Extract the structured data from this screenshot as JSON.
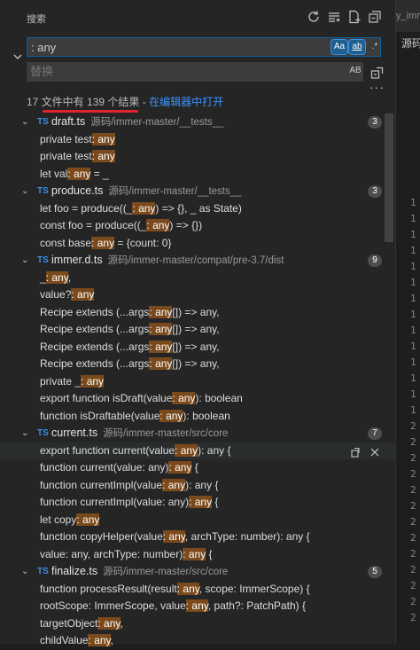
{
  "header": {
    "title": "搜索",
    "icons": [
      "refresh-icon",
      "clear-results-icon",
      "new-search-editor-icon",
      "collapse-all-icon"
    ]
  },
  "search": {
    "value": ": any",
    "options": [
      "Aa",
      "ab",
      ".*"
    ]
  },
  "replace": {
    "placeholder": "替换",
    "preserve_case": "AB"
  },
  "summary": {
    "prefix": "17 文件中有 ",
    "count": "139",
    "suffix": " 个结果 - ",
    "open_link": "在编辑器中打开"
  },
  "editor": {
    "tab": "y_imm",
    "crumb": "源码",
    "lines": [
      "1",
      "1",
      "1",
      "1",
      "1",
      "1",
      "1",
      "1",
      "1",
      "1",
      "1",
      "1",
      "1",
      "1",
      "2",
      "2",
      "2",
      "2",
      "2",
      "2",
      "2",
      "2",
      "2",
      "2",
      "2",
      "2",
      "2"
    ]
  },
  "files": [
    {
      "name": "draft.ts",
      "path": "源码/immer-master/__tests__",
      "count": "3",
      "matches": [
        {
          "before": "private test",
          "match": ": any",
          "after": ""
        },
        {
          "before": "private test",
          "match": ": any",
          "after": ""
        },
        {
          "before": "let val",
          "match": ": any",
          "after": " = _"
        }
      ]
    },
    {
      "name": "produce.ts",
      "path": "源码/immer-master/__tests__",
      "count": "3",
      "matches": [
        {
          "before": "let foo = produce((_",
          "match": ": any",
          "after": ") => {}, _ as State)"
        },
        {
          "before": "const foo = produce((_",
          "match": ": any",
          "after": ") => {})"
        },
        {
          "before": "const base",
          "match": ": any",
          "after": " = {count: 0}"
        }
      ]
    },
    {
      "name": "immer.d.ts",
      "path": "源码/immer-master/compat/pre-3.7/dist",
      "count": "9",
      "matches": [
        {
          "before": "_",
          "match": ": any",
          "after": ","
        },
        {
          "before": "value?",
          "match": ": any",
          "after": ""
        },
        {
          "before": "Recipe extends (...args",
          "match": ": any",
          "after": "[]) => any,"
        },
        {
          "before": "Recipe extends (...args",
          "match": ": any",
          "after": "[]) => any,"
        },
        {
          "before": "Recipe extends (...args",
          "match": ": any",
          "after": "[]) => any,"
        },
        {
          "before": "Recipe extends (...args",
          "match": ": any",
          "after": "[]) => any,"
        },
        {
          "before": "private _",
          "match": ": any",
          "after": ""
        },
        {
          "before": "export function isDraft(value",
          "match": ": any",
          "after": "): boolean"
        },
        {
          "before": "function isDraftable(value",
          "match": ": any",
          "after": "): boolean"
        }
      ]
    },
    {
      "name": "current.ts",
      "path": "源码/immer-master/src/core",
      "count": "7",
      "matches": [
        {
          "before": "export function current(value",
          "match": ": any",
          "after": "): any {"
        },
        {
          "before": "function current(value: any)",
          "match": ": any",
          "after": " {"
        },
        {
          "before": "function currentImpl(value",
          "match": ": any",
          "after": "): any {"
        },
        {
          "before": "function currentImpl(value: any)",
          "match": ": any",
          "after": " {"
        },
        {
          "before": "let copy",
          "match": ": any",
          "after": ""
        },
        {
          "before": "function copyHelper(value",
          "match": ": any",
          "after": ", archType: number): any {"
        },
        {
          "before": "value: any, archType: number)",
          "match": ": any",
          "after": " {"
        }
      ]
    },
    {
      "name": "finalize.ts",
      "path": "源码/immer-master/src/core",
      "count": "5",
      "matches": [
        {
          "before": "function processResult(result",
          "match": ": any",
          "after": ", scope: ImmerScope) {"
        },
        {
          "before": "rootScope: ImmerScope, value",
          "match": ": any",
          "after": ", path?: PatchPath) {"
        },
        {
          "before": "targetObject",
          "match": ": any",
          "after": ","
        },
        {
          "before": "childValue",
          "match": ": any",
          "after": ","
        }
      ]
    }
  ],
  "hover_row": {
    "file": 3,
    "match": 0
  }
}
